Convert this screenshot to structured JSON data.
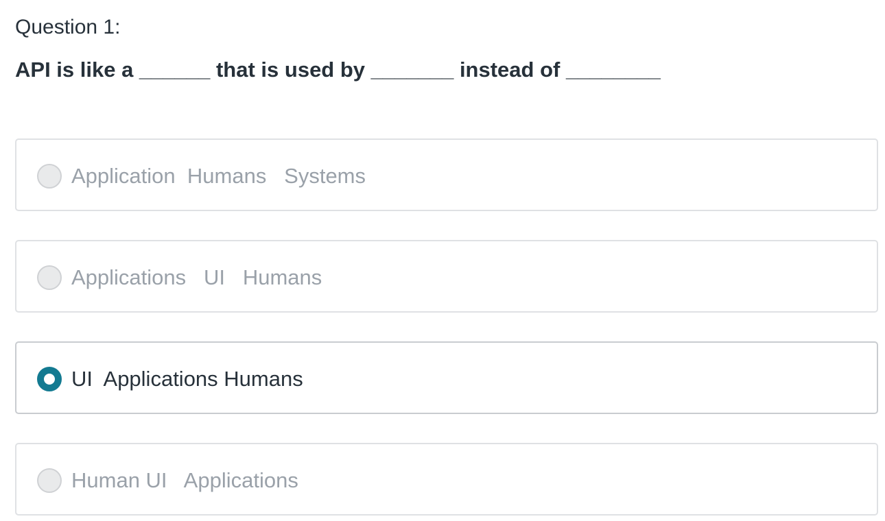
{
  "question": {
    "label": "Question 1:",
    "text": "API is like a ______ that is used by _______ instead of ________"
  },
  "options": [
    {
      "label": "Application  Humans   Systems",
      "selected": false
    },
    {
      "label": "Applications   UI   Humans",
      "selected": false
    },
    {
      "label": "UI  Applications Humans",
      "selected": true
    },
    {
      "label": "Human UI   Applications",
      "selected": false
    }
  ],
  "colors": {
    "accent": "#137a91",
    "text": "#27313a",
    "muted_text": "#9aa1a9",
    "border": "#dfe1e4"
  }
}
